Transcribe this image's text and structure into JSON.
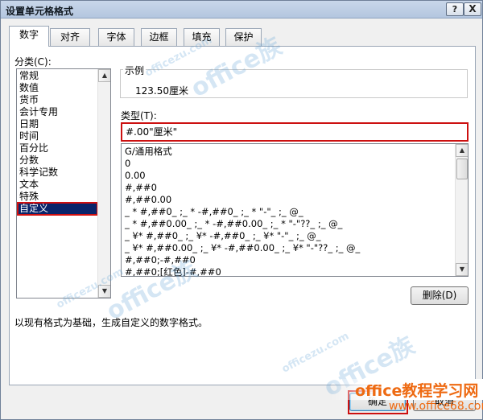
{
  "window": {
    "title": "设置单元格格式",
    "help_label": "?",
    "close_label": "X"
  },
  "tabs": [
    {
      "label": "数字",
      "active": true
    },
    {
      "label": "对齐",
      "active": false
    },
    {
      "label": "字体",
      "active": false
    },
    {
      "label": "边框",
      "active": false
    },
    {
      "label": "填充",
      "active": false
    },
    {
      "label": "保护",
      "active": false
    }
  ],
  "category": {
    "label": "分类(C):",
    "items": [
      "常规",
      "数值",
      "货币",
      "会计专用",
      "日期",
      "时间",
      "百分比",
      "分数",
      "科学记数",
      "文本",
      "特殊",
      "自定义"
    ],
    "selected": "自定义"
  },
  "sample": {
    "label": "示例",
    "value": "123.50厘米"
  },
  "type": {
    "label": "类型(T):",
    "value": "#.00\"厘米\"",
    "items": [
      "G/通用格式",
      "0",
      "0.00",
      "#,##0",
      "#,##0.00",
      "_ * #,##0_ ;_ * -#,##0_ ;_ * \"-\"_ ;_ @_",
      "_ * #,##0.00_ ;_ * -#,##0.00_ ;_ * \"-\"??_ ;_ @_",
      "_ ¥* #,##0_ ;_ ¥* -#,##0_ ;_ ¥* \"-\"_ ;_ @_",
      "_ ¥* #,##0.00_ ;_ ¥* -#,##0.00_ ;_ ¥* \"-\"??_ ;_ @_",
      "#,##0;-#,##0",
      "#,##0;[红色]-#,##0"
    ]
  },
  "buttons": {
    "delete": "删除(D)",
    "ok": "确定",
    "cancel": "取消"
  },
  "description": "以现有格式为基础，生成自定义的数字格式。",
  "watermark": {
    "site_name": "office教程学习网",
    "site_url": "www.office68.com",
    "brand": "office族",
    "domain": "officezu.com"
  },
  "colors": {
    "highlight": "#cc1010",
    "selection": "#0a246a",
    "watermark": "#ee6a12"
  },
  "icons": {
    "scroll_up": "▲",
    "scroll_down": "▼"
  }
}
